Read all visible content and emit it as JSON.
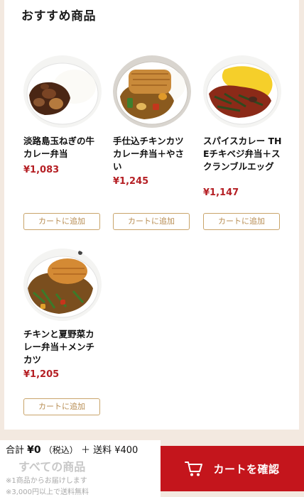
{
  "section": {
    "title": "おすすめ商品"
  },
  "products": [
    {
      "name": "淡路島玉ねぎの牛カレー弁当",
      "price": "¥1,083",
      "button": "カートに追加",
      "image_icon": "beef-curry-bowl"
    },
    {
      "name": "手仕込チキンカツカレー弁当＋やさい",
      "price": "¥1,245",
      "button": "カートに追加",
      "image_icon": "chicken-katsu-curry-bowl"
    },
    {
      "name": "スパイスカレー THEチキベジ弁当＋スクランブルエッグ",
      "price": "¥1,147",
      "button": "カートに追加",
      "image_icon": "spice-curry-egg-bowl"
    },
    {
      "name": "チキンと夏野菜カレー弁当＋メンチカツ",
      "price": "¥1,205",
      "button": "カートに追加",
      "image_icon": "summer-veg-menchi-curry-bowl"
    }
  ],
  "footer": {
    "total_label": "合計",
    "total_amount": "¥0",
    "tax_label": "（税込）",
    "shipping_text": "＋ 送料 ¥400",
    "all_items": "すべての商品",
    "note1": "※1商品からお届けします",
    "note2": "※3,000円以上で送料無料",
    "cart_button": "カートを確認"
  },
  "colors": {
    "price": "#b51f24",
    "button_border": "#c9a46a",
    "cart_button_bg": "#c4151c",
    "page_bg": "#f3e9e0"
  }
}
